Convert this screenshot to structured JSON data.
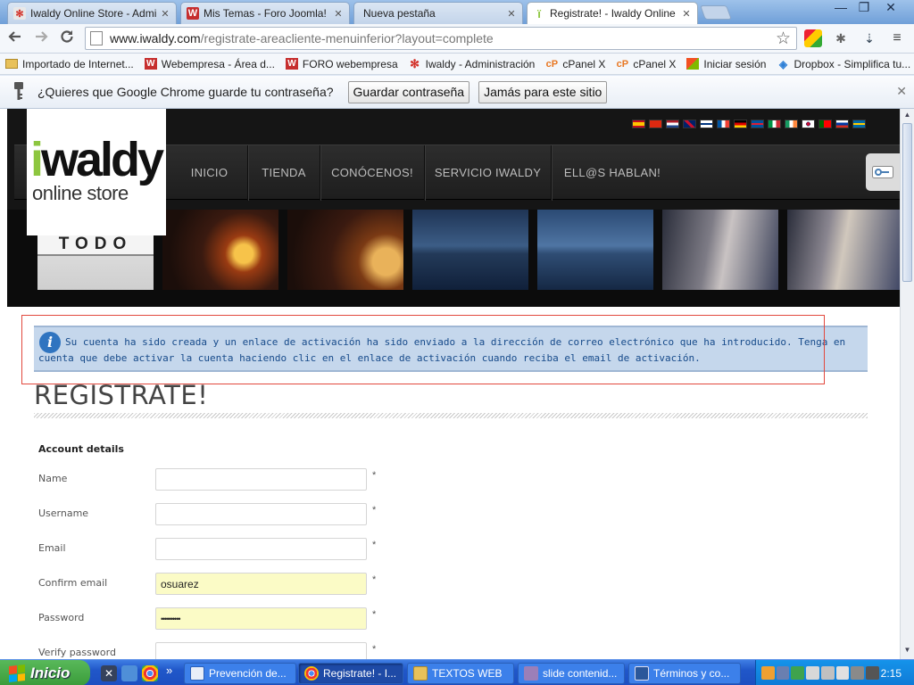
{
  "browser": {
    "tabs": [
      {
        "title": "Iwaldy Online Store - Admini",
        "favicon": "joomla-icon",
        "color": "#e43"
      },
      {
        "title": "Mis Temas - Foro Joomla! - S",
        "favicon": "webempresa-icon",
        "color": "#c33"
      },
      {
        "title": "Nueva pestaña",
        "favicon": "",
        "color": ""
      },
      {
        "title": "Registrate! - Iwaldy Online S",
        "favicon": "iwaldy-icon",
        "color": "#8dc63f"
      }
    ],
    "close_glyph": "✕",
    "window_controls": {
      "minimize": "—",
      "maximize": "❐",
      "close": "✕"
    },
    "url_host": "www.iwaldy.com",
    "url_path": "/registrate-areacliente-menuinferior?layout=complete",
    "bookmarks": [
      {
        "label": "Importado de Internet...",
        "icon": "folder-icon"
      },
      {
        "label": "Webempresa - Área d...",
        "icon": "webempresa-icon"
      },
      {
        "label": "FORO webempresa",
        "icon": "webempresa-icon"
      },
      {
        "label": "Iwaldy - Administración",
        "icon": "joomla-icon"
      },
      {
        "label": "cPanel X",
        "icon": "cpanel-icon"
      },
      {
        "label": "cPanel X",
        "icon": "cpanel-icon"
      },
      {
        "label": "Iniciar sesión",
        "icon": "windows-live-icon"
      },
      {
        "label": "Dropbox - Simplifica tu...",
        "icon": "dropbox-icon"
      }
    ],
    "infobar": {
      "question": "¿Quieres que Google Chrome guarde tu contraseña?",
      "save_label": "Guardar contraseña",
      "never_label": "Jamás para este sitio",
      "close_glyph": "✕"
    }
  },
  "site": {
    "logo_mark": "waldy",
    "logo_i": "i",
    "logo_sub": "online store",
    "flags": [
      "es",
      "cn",
      "nl",
      "gb",
      "fi",
      "fr",
      "de",
      "is",
      "it",
      "ie",
      "kr",
      "pt",
      "ru",
      "se"
    ],
    "nav": [
      "INICIO",
      "TIENDA",
      "CONÓCENOS!",
      "SERVICIO IWALDY",
      "ELL@S HABLAN!"
    ],
    "strip_caption": "TODO"
  },
  "notice": {
    "message": "Su cuenta ha sido creada y un enlace de activación ha sido enviado a la dirección de correo electrónico que ha introducido. Tenga en cuenta que debe activar la cuenta haciendo clic en el enlace de activación cuando reciba el email de activación."
  },
  "form": {
    "title": "REGISTRATE!",
    "legend": "Account details",
    "required_mark": "*",
    "fields": [
      {
        "label": "Name",
        "value": ""
      },
      {
        "label": "Username",
        "value": ""
      },
      {
        "label": "Email",
        "value": ""
      },
      {
        "label": "Confirm email",
        "value": "osuarez"
      },
      {
        "label": "Password",
        "value": "••••••••••"
      },
      {
        "label": "Verify password",
        "value": ""
      }
    ]
  },
  "taskbar": {
    "start_label": "Inicio",
    "buttons": [
      {
        "label": "Prevención de...",
        "icon": "outlook-icon"
      },
      {
        "label": "Registrate! - I...",
        "icon": "chrome-icon"
      },
      {
        "label": "TEXTOS WEB",
        "icon": "folder-icon"
      },
      {
        "label": "slide contenid...",
        "icon": "app-icon"
      },
      {
        "label": "Términos y co...",
        "icon": "word-icon"
      }
    ],
    "more_glyph": "»",
    "clock": "2:15"
  }
}
